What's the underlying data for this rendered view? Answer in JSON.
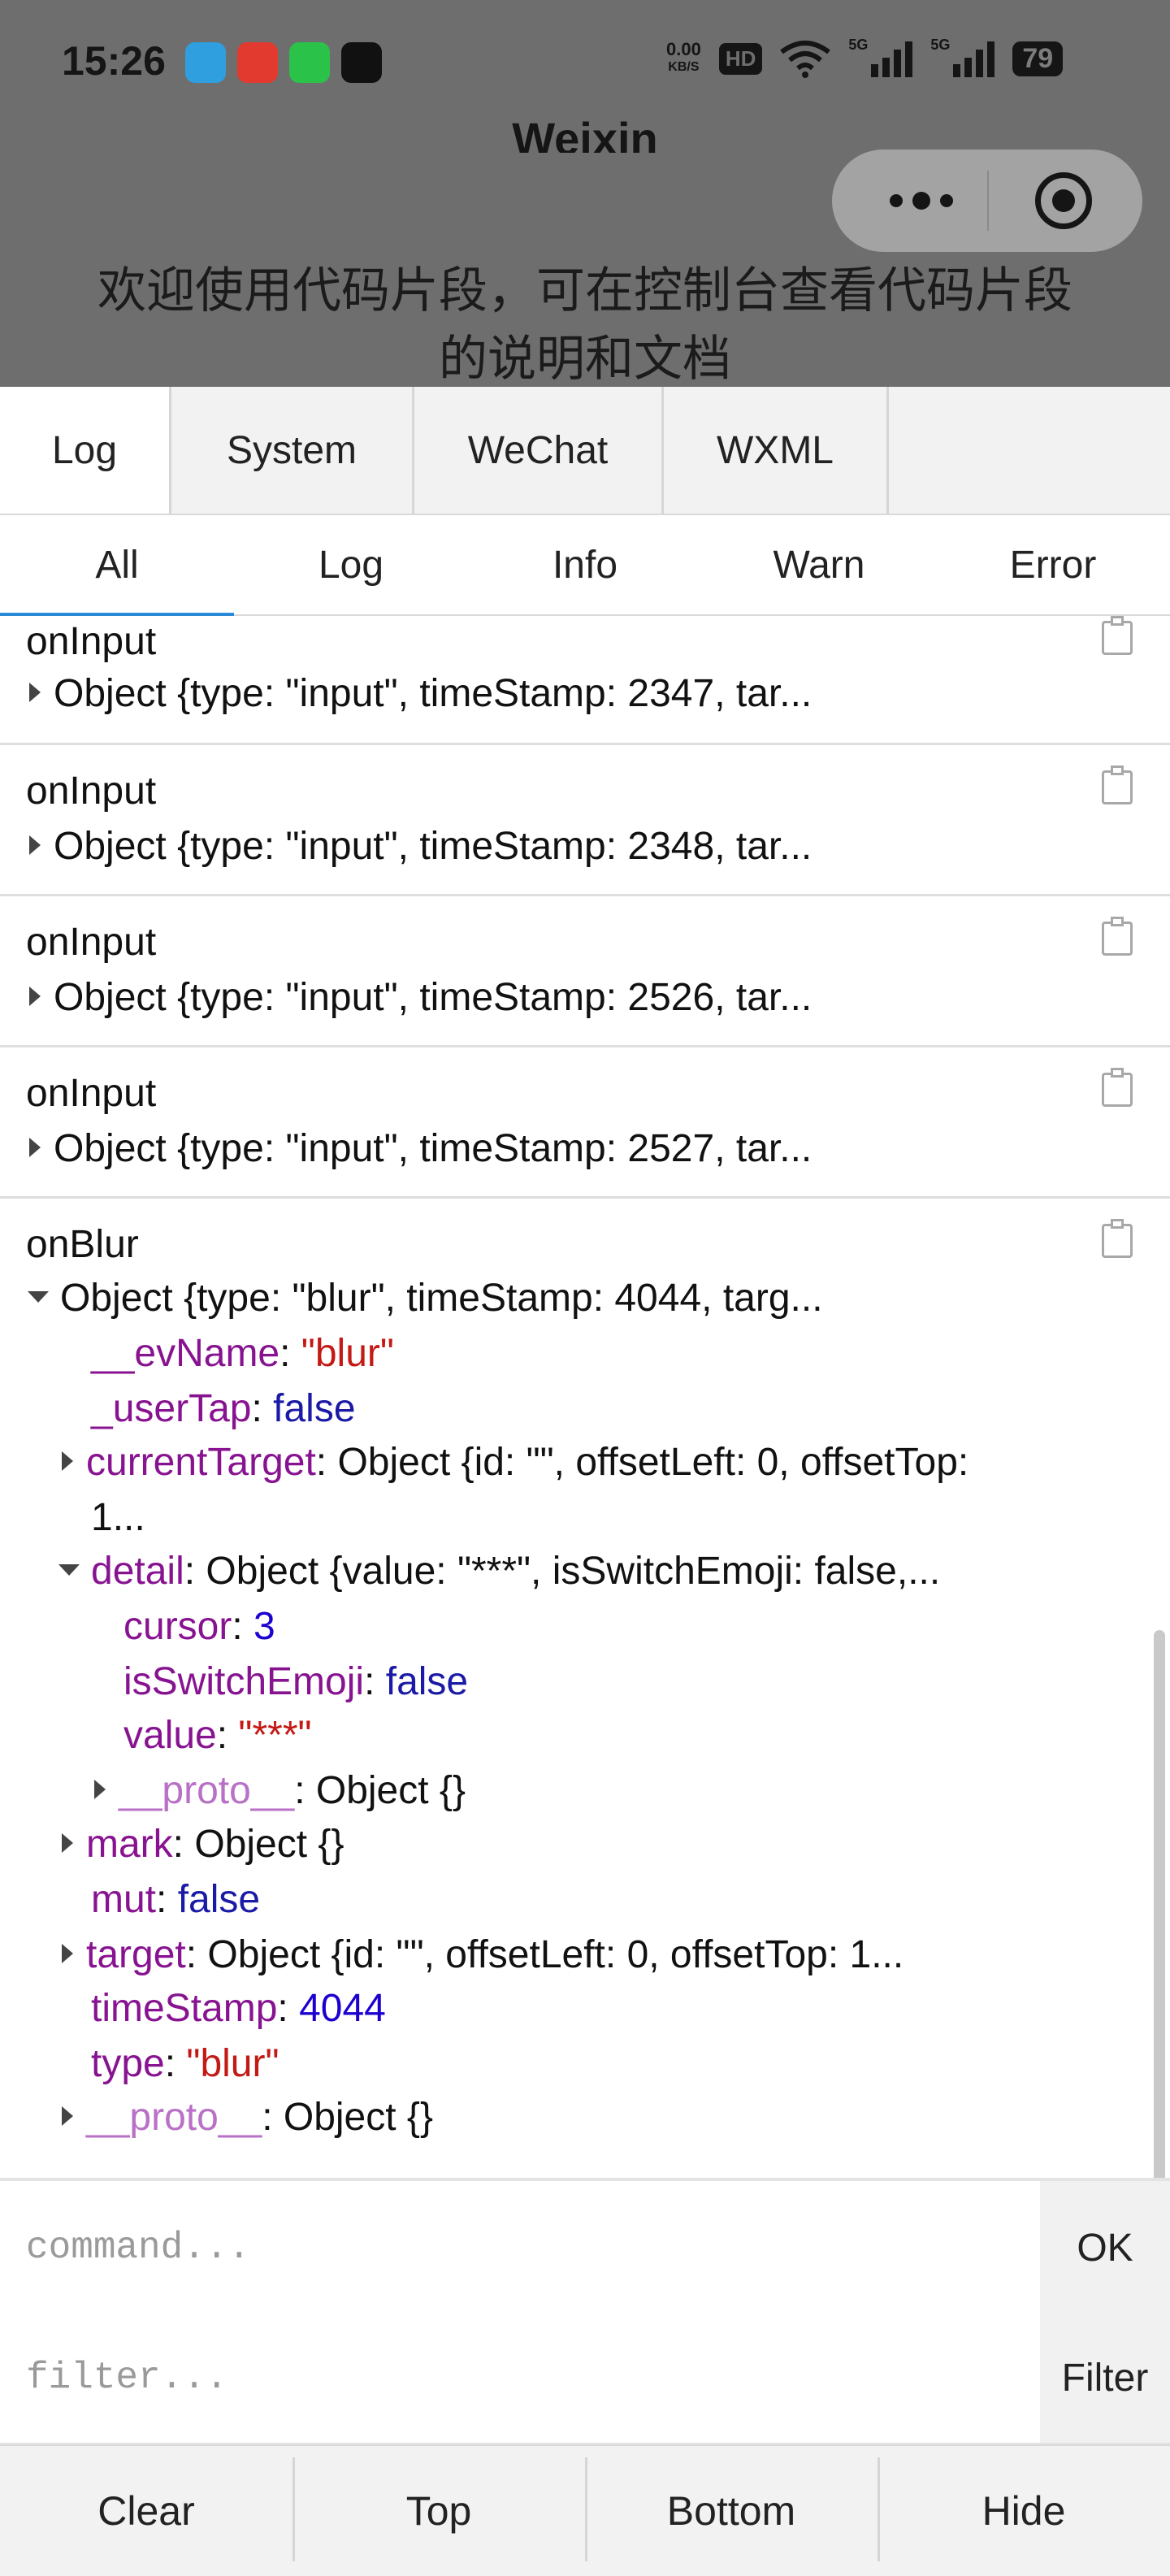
{
  "status_bar": {
    "time": "15:26",
    "net_speed": "0.00",
    "net_unit": "KB/S",
    "hd": "HD",
    "signal_1": "5G",
    "signal_2": "5G",
    "battery": "79"
  },
  "app_icon_names": [
    "telegram-icon",
    "redbook-icon",
    "green-app-icon",
    "tiktok-icon"
  ],
  "header": {
    "title": "Weixin",
    "welcome_text": "欢迎使用代码片段，可在控制台查看代码片段的说明和文档"
  },
  "console": {
    "panel_tabs": [
      {
        "label": "Log",
        "active": true
      },
      {
        "label": "System",
        "active": false
      },
      {
        "label": "WeChat",
        "active": false
      },
      {
        "label": "WXML",
        "active": false
      }
    ],
    "level_tabs": [
      {
        "label": "All",
        "active": true
      },
      {
        "label": "Log",
        "active": false
      },
      {
        "label": "Info",
        "active": false
      },
      {
        "label": "Warn",
        "active": false
      },
      {
        "label": "Error",
        "active": false
      }
    ],
    "entries": [
      {
        "name": "onInput",
        "summary": "Object {type: \"input\", timeStamp: 2347, tar..."
      },
      {
        "name": "onInput",
        "summary": "Object {type: \"input\", timeStamp: 2348, tar..."
      },
      {
        "name": "onInput",
        "summary": "Object {type: \"input\", timeStamp: 2526, tar..."
      },
      {
        "name": "onInput",
        "summary": "Object {type: \"input\", timeStamp: 2527, tar..."
      }
    ],
    "expanded": {
      "name": "onBlur",
      "summary": "Object {type: \"blur\", timeStamp: 4044, targ...",
      "evName_key": "__evName",
      "evName_val": "\"blur\"",
      "userTap_key": "_userTap",
      "userTap_val": "false",
      "currentTarget_key": "currentTarget",
      "currentTarget_val": "Object {id: \"\", offsetLeft: 0, offsetTop:",
      "currentTarget_cont": "1...",
      "detail_key": "detail",
      "detail_val": "Object {value: \"***\", isSwitchEmoji: false,...",
      "cursor_key": "cursor",
      "cursor_val": "3",
      "isSwitchEmoji_key": "isSwitchEmoji",
      "isSwitchEmoji_val": "false",
      "value_key": "value",
      "value_val": "\"***\"",
      "detail_proto_key": "__proto__",
      "detail_proto_val": "Object {}",
      "mark_key": "mark",
      "mark_val": "Object {}",
      "mut_key": "mut",
      "mut_val": "false",
      "target_key": "target",
      "target_val": "Object {id: \"\", offsetLeft: 0, offsetTop: 1...",
      "timeStamp_key": "timeStamp",
      "timeStamp_val": "4044",
      "type_key": "type",
      "type_val": "\"blur\"",
      "proto_key": "__proto__",
      "proto_val": "Object {}"
    },
    "command": {
      "placeholder": "command...",
      "value": "",
      "button": "OK"
    },
    "filter": {
      "placeholder": "filter...",
      "value": "",
      "button": "Filter"
    },
    "bottom_buttons": [
      "Clear",
      "Top",
      "Bottom",
      "Hide"
    ]
  }
}
